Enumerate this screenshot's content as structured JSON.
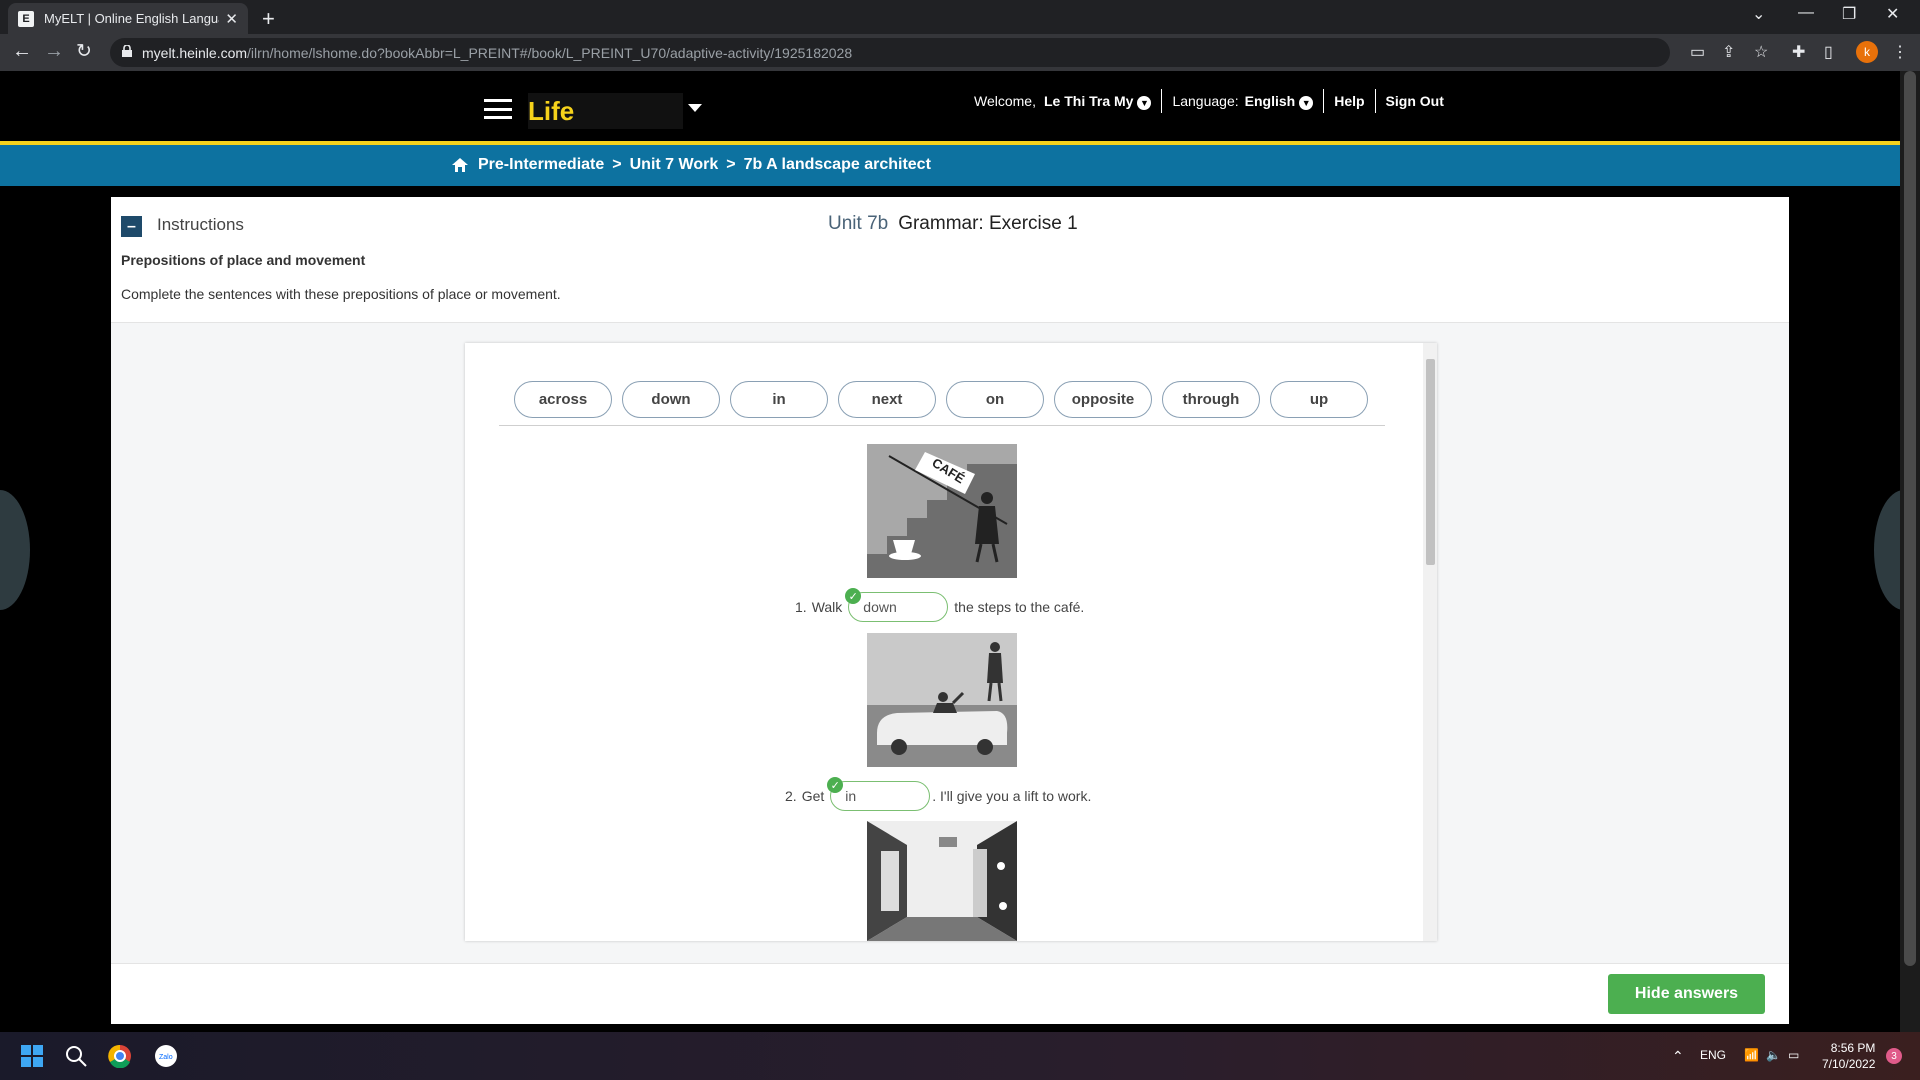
{
  "browser": {
    "tab_title": "MyELT | Online English Language",
    "favicon_letter": "E",
    "url_host": "myelt.heinle.com",
    "url_path": "/ilrn/home/lshome.do?bookAbbr=L_PREINT#/book/L_PREINT_U70/adaptive-activity/1925182028",
    "profile_initial": "k"
  },
  "header": {
    "logo": "Life",
    "welcome_label": "Welcome,",
    "user_name": "Le Thi Tra My",
    "language_label": "Language:",
    "language_value": "English",
    "help": "Help",
    "sign_out": "Sign Out"
  },
  "breadcrumb": {
    "level": "Pre-Intermediate",
    "unit": "Unit 7 Work",
    "lesson": "7b A landscape architect",
    "separator": ">"
  },
  "instructions": {
    "label": "Instructions",
    "unit": "Unit 7b",
    "exercise_title": "Grammar: Exercise 1",
    "subtitle": "Prepositions of place and movement",
    "text": "Complete the sentences with these prepositions of place or movement."
  },
  "word_bank": [
    "across",
    "down",
    "in",
    "next",
    "on",
    "opposite",
    "through",
    "up"
  ],
  "items": [
    {
      "number": "1.",
      "before": "Walk",
      "answer": "down",
      "after": "the steps to the café.",
      "image": "cafe-steps"
    },
    {
      "number": "2.",
      "before": "Get",
      "answer": "in",
      "after": ". I'll give you a lift to work.",
      "image": "car"
    }
  ],
  "picture_text": {
    "cafe_sign": "CAFÉ"
  },
  "footer": {
    "hide_answers": "Hide answers"
  },
  "taskbar": {
    "lang": "ENG",
    "time": "8:56 PM",
    "date": "7/10/2022",
    "notifications": "3"
  }
}
